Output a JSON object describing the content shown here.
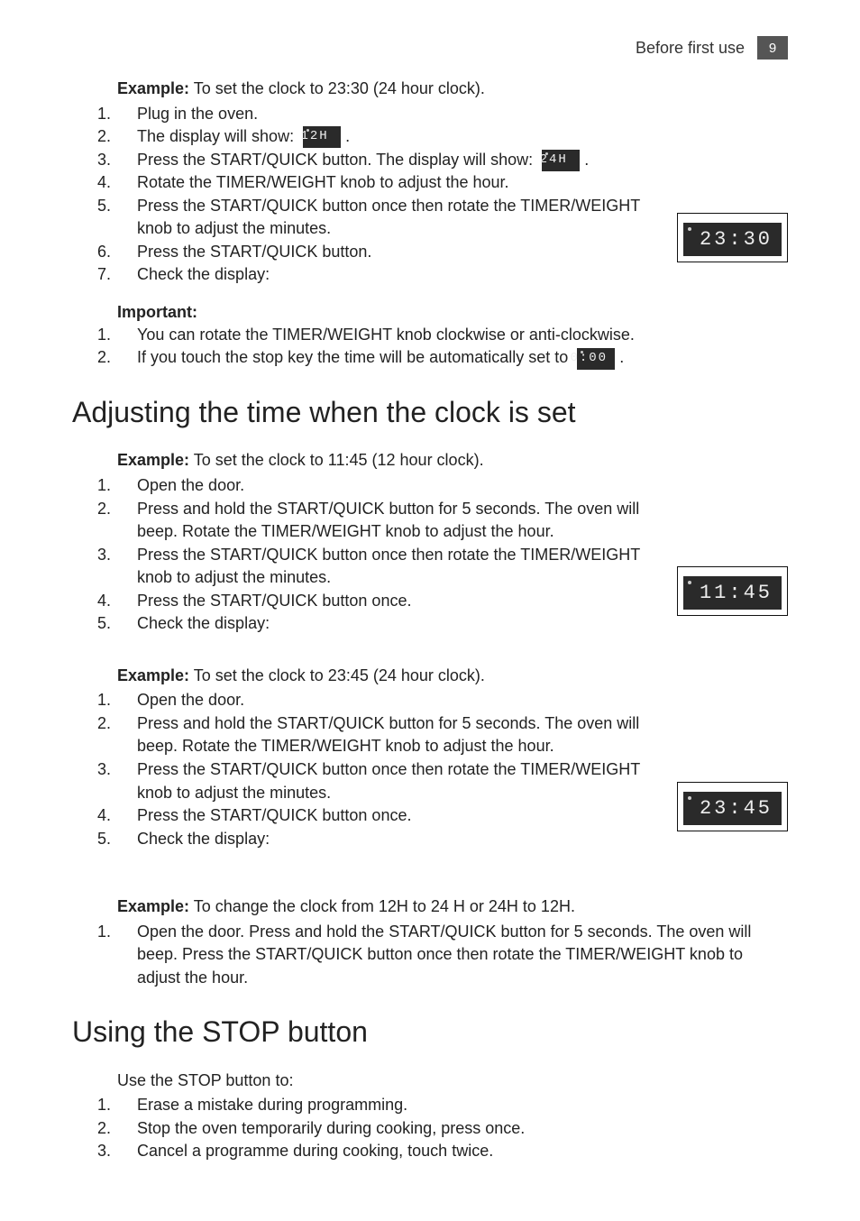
{
  "header": {
    "section": "Before first use",
    "page": "9"
  },
  "intro": {
    "exampleLabel": "Example:",
    "exampleText": "To set the clock to 23:30 (24 hour clock).",
    "steps": {
      "s1": "Plug in the oven.",
      "s2a": "The display will show:",
      "s2lcd": "12H",
      "s3a": "Press the START/QUICK button. The display will show:",
      "s3lcd": "24H",
      "s4": "Rotate the TIMER/WEIGHT knob to adjust the hour.",
      "s5": "Press the START/QUICK button once then rotate the TIMER/WEIGHT knob to adjust the minutes.",
      "s6": "Press the START/QUICK button.",
      "s7": "Check the display:"
    },
    "frame": "23:30"
  },
  "important": {
    "head": "Important:",
    "i1": "You can rotate the TIMER/WEIGHT knob clockwise or anti-clockwise.",
    "i2a": "If you touch the stop key the time will be automatically set to",
    "i2lcd": "0:00"
  },
  "adjust": {
    "title": "Adjusting the time when the clock is set",
    "ex1": {
      "label": "Example:",
      "text": "To set the clock to 11:45 (12 hour clock).",
      "s1": "Open the door.",
      "s2": "Press and hold the START/QUICK button for 5 seconds. The oven will beep. Rotate the TIMER/WEIGHT knob to adjust the hour.",
      "s3": "Press the START/QUICK button once then rotate the TIMER/WEIGHT knob to adjust the minutes.",
      "s4": "Press the START/QUICK button once.",
      "s5": "Check the display:",
      "frame": "11:45"
    },
    "ex2": {
      "label": "Example:",
      "text": "To set the clock to 23:45 (24 hour clock).",
      "s1": "Open the door.",
      "s2": "Press and hold the START/QUICK button for 5 seconds. The oven will beep. Rotate the TIMER/WEIGHT knob to adjust the hour.",
      "s3": "Press the START/QUICK button once then rotate the TIMER/WEIGHT knob to adjust the minutes.",
      "s4": "Press the START/QUICK button once.",
      "s5": "Check the display:",
      "frame": "23:45"
    },
    "ex3": {
      "label": "Example:",
      "text": "To change the clock from 12H to 24 H or 24H to 12H.",
      "s1": "Open the door. Press and hold the START/QUICK button for 5 seconds. The oven will beep. Press the START/QUICK button once then rotate the TIMER/WEIGHT knob to adjust the hour."
    }
  },
  "stop": {
    "title": "Using the STOP button",
    "lead": "Use the STOP button to:",
    "s1": "Erase a mistake during programming.",
    "s2": "Stop the oven temporarily during cooking, press once.",
    "s3": "Cancel a programme during cooking, touch twice."
  }
}
